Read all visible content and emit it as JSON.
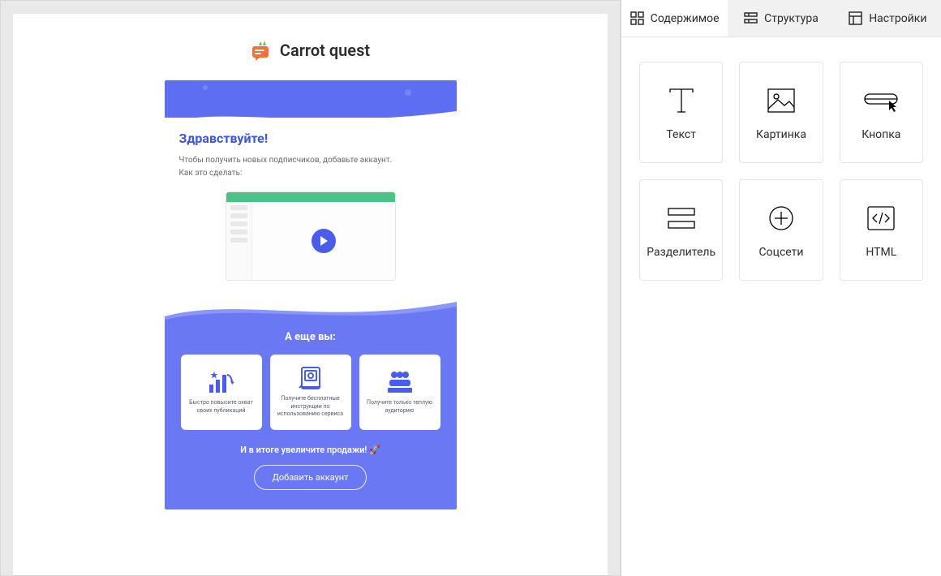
{
  "brand": {
    "name": "Carrot quest"
  },
  "email": {
    "greeting": "Здравствуйте!",
    "line1": "Чтобы получить новых подписчиков, добавьте аккаунт.",
    "line2": "Как это сделать:",
    "also_title": "А еще вы:",
    "cards": [
      {
        "text": "Быстро повысите охват своих публикаций"
      },
      {
        "text": "Получите бесплатные инструкции по использованию сервиса"
      },
      {
        "text": "Получите только теплую аудиторию"
      }
    ],
    "tagline": "И в итоге увеличите продажи! 🚀",
    "cta": "Добавить аккаунт"
  },
  "sidebar": {
    "tabs": [
      {
        "label": "Содержимое",
        "active": true
      },
      {
        "label": "Структура",
        "active": false
      },
      {
        "label": "Настройки",
        "active": false
      }
    ],
    "blocks": [
      {
        "label": "Текст"
      },
      {
        "label": "Картинка"
      },
      {
        "label": "Кнопка"
      },
      {
        "label": "Разделитель"
      },
      {
        "label": "Соцсети"
      },
      {
        "label": "HTML"
      }
    ]
  },
  "colors": {
    "accent": "#6a78f4",
    "accent_dark": "#4a5de8",
    "brand_orange": "#f0713a",
    "green": "#49c386"
  }
}
